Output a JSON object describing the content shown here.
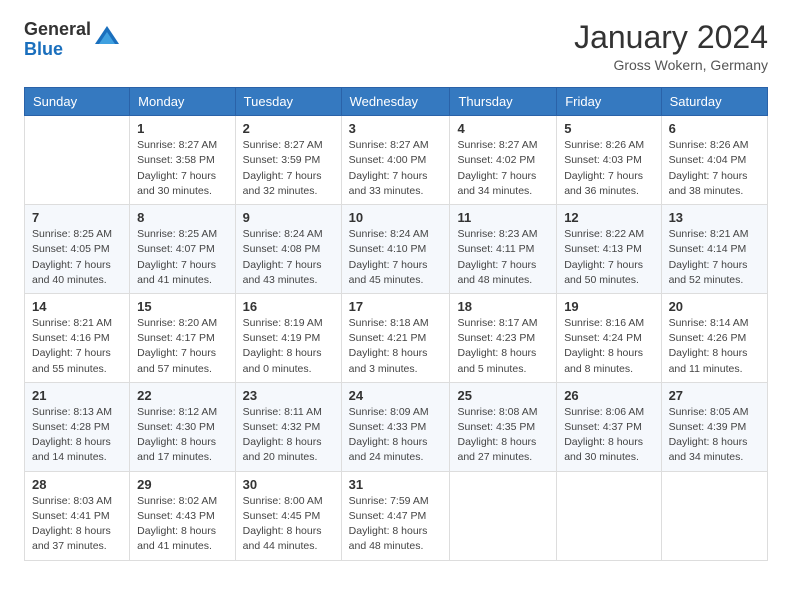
{
  "header": {
    "logo_general": "General",
    "logo_blue": "Blue",
    "month": "January 2024",
    "location": "Gross Wokern, Germany"
  },
  "weekdays": [
    "Sunday",
    "Monday",
    "Tuesday",
    "Wednesday",
    "Thursday",
    "Friday",
    "Saturday"
  ],
  "weeks": [
    [
      {
        "day": "",
        "sunrise": "",
        "sunset": "",
        "daylight": ""
      },
      {
        "day": "1",
        "sunrise": "Sunrise: 8:27 AM",
        "sunset": "Sunset: 3:58 PM",
        "daylight": "Daylight: 7 hours and 30 minutes."
      },
      {
        "day": "2",
        "sunrise": "Sunrise: 8:27 AM",
        "sunset": "Sunset: 3:59 PM",
        "daylight": "Daylight: 7 hours and 32 minutes."
      },
      {
        "day": "3",
        "sunrise": "Sunrise: 8:27 AM",
        "sunset": "Sunset: 4:00 PM",
        "daylight": "Daylight: 7 hours and 33 minutes."
      },
      {
        "day": "4",
        "sunrise": "Sunrise: 8:27 AM",
        "sunset": "Sunset: 4:02 PM",
        "daylight": "Daylight: 7 hours and 34 minutes."
      },
      {
        "day": "5",
        "sunrise": "Sunrise: 8:26 AM",
        "sunset": "Sunset: 4:03 PM",
        "daylight": "Daylight: 7 hours and 36 minutes."
      },
      {
        "day": "6",
        "sunrise": "Sunrise: 8:26 AM",
        "sunset": "Sunset: 4:04 PM",
        "daylight": "Daylight: 7 hours and 38 minutes."
      }
    ],
    [
      {
        "day": "7",
        "sunrise": "Sunrise: 8:25 AM",
        "sunset": "Sunset: 4:05 PM",
        "daylight": "Daylight: 7 hours and 40 minutes."
      },
      {
        "day": "8",
        "sunrise": "Sunrise: 8:25 AM",
        "sunset": "Sunset: 4:07 PM",
        "daylight": "Daylight: 7 hours and 41 minutes."
      },
      {
        "day": "9",
        "sunrise": "Sunrise: 8:24 AM",
        "sunset": "Sunset: 4:08 PM",
        "daylight": "Daylight: 7 hours and 43 minutes."
      },
      {
        "day": "10",
        "sunrise": "Sunrise: 8:24 AM",
        "sunset": "Sunset: 4:10 PM",
        "daylight": "Daylight: 7 hours and 45 minutes."
      },
      {
        "day": "11",
        "sunrise": "Sunrise: 8:23 AM",
        "sunset": "Sunset: 4:11 PM",
        "daylight": "Daylight: 7 hours and 48 minutes."
      },
      {
        "day": "12",
        "sunrise": "Sunrise: 8:22 AM",
        "sunset": "Sunset: 4:13 PM",
        "daylight": "Daylight: 7 hours and 50 minutes."
      },
      {
        "day": "13",
        "sunrise": "Sunrise: 8:21 AM",
        "sunset": "Sunset: 4:14 PM",
        "daylight": "Daylight: 7 hours and 52 minutes."
      }
    ],
    [
      {
        "day": "14",
        "sunrise": "Sunrise: 8:21 AM",
        "sunset": "Sunset: 4:16 PM",
        "daylight": "Daylight: 7 hours and 55 minutes."
      },
      {
        "day": "15",
        "sunrise": "Sunrise: 8:20 AM",
        "sunset": "Sunset: 4:17 PM",
        "daylight": "Daylight: 7 hours and 57 minutes."
      },
      {
        "day": "16",
        "sunrise": "Sunrise: 8:19 AM",
        "sunset": "Sunset: 4:19 PM",
        "daylight": "Daylight: 8 hours and 0 minutes."
      },
      {
        "day": "17",
        "sunrise": "Sunrise: 8:18 AM",
        "sunset": "Sunset: 4:21 PM",
        "daylight": "Daylight: 8 hours and 3 minutes."
      },
      {
        "day": "18",
        "sunrise": "Sunrise: 8:17 AM",
        "sunset": "Sunset: 4:23 PM",
        "daylight": "Daylight: 8 hours and 5 minutes."
      },
      {
        "day": "19",
        "sunrise": "Sunrise: 8:16 AM",
        "sunset": "Sunset: 4:24 PM",
        "daylight": "Daylight: 8 hours and 8 minutes."
      },
      {
        "day": "20",
        "sunrise": "Sunrise: 8:14 AM",
        "sunset": "Sunset: 4:26 PM",
        "daylight": "Daylight: 8 hours and 11 minutes."
      }
    ],
    [
      {
        "day": "21",
        "sunrise": "Sunrise: 8:13 AM",
        "sunset": "Sunset: 4:28 PM",
        "daylight": "Daylight: 8 hours and 14 minutes."
      },
      {
        "day": "22",
        "sunrise": "Sunrise: 8:12 AM",
        "sunset": "Sunset: 4:30 PM",
        "daylight": "Daylight: 8 hours and 17 minutes."
      },
      {
        "day": "23",
        "sunrise": "Sunrise: 8:11 AM",
        "sunset": "Sunset: 4:32 PM",
        "daylight": "Daylight: 8 hours and 20 minutes."
      },
      {
        "day": "24",
        "sunrise": "Sunrise: 8:09 AM",
        "sunset": "Sunset: 4:33 PM",
        "daylight": "Daylight: 8 hours and 24 minutes."
      },
      {
        "day": "25",
        "sunrise": "Sunrise: 8:08 AM",
        "sunset": "Sunset: 4:35 PM",
        "daylight": "Daylight: 8 hours and 27 minutes."
      },
      {
        "day": "26",
        "sunrise": "Sunrise: 8:06 AM",
        "sunset": "Sunset: 4:37 PM",
        "daylight": "Daylight: 8 hours and 30 minutes."
      },
      {
        "day": "27",
        "sunrise": "Sunrise: 8:05 AM",
        "sunset": "Sunset: 4:39 PM",
        "daylight": "Daylight: 8 hours and 34 minutes."
      }
    ],
    [
      {
        "day": "28",
        "sunrise": "Sunrise: 8:03 AM",
        "sunset": "Sunset: 4:41 PM",
        "daylight": "Daylight: 8 hours and 37 minutes."
      },
      {
        "day": "29",
        "sunrise": "Sunrise: 8:02 AM",
        "sunset": "Sunset: 4:43 PM",
        "daylight": "Daylight: 8 hours and 41 minutes."
      },
      {
        "day": "30",
        "sunrise": "Sunrise: 8:00 AM",
        "sunset": "Sunset: 4:45 PM",
        "daylight": "Daylight: 8 hours and 44 minutes."
      },
      {
        "day": "31",
        "sunrise": "Sunrise: 7:59 AM",
        "sunset": "Sunset: 4:47 PM",
        "daylight": "Daylight: 8 hours and 48 minutes."
      },
      {
        "day": "",
        "sunrise": "",
        "sunset": "",
        "daylight": ""
      },
      {
        "day": "",
        "sunrise": "",
        "sunset": "",
        "daylight": ""
      },
      {
        "day": "",
        "sunrise": "",
        "sunset": "",
        "daylight": ""
      }
    ]
  ]
}
